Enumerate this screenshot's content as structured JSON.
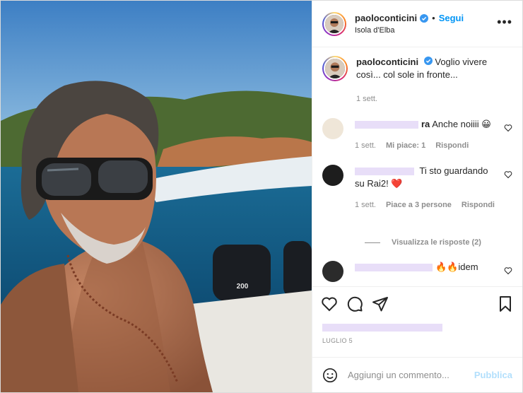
{
  "post": {
    "username": "paoloconticini",
    "follow_label": "Segui",
    "separator": "•",
    "location": "Isola d'Elba",
    "more_label": "•••",
    "caption": "Voglio vivere così... col sole in fronte...",
    "caption_time": "1 sett.",
    "date": "LUGLIO 5"
  },
  "media": {
    "boat_engine_label": "200"
  },
  "comments": [
    {
      "username_visible": "ra",
      "text": "Anche noiiii 😀",
      "time": "1 sett.",
      "likes": "Mi piace: 1",
      "reply": "Rispondi"
    },
    {
      "username_visible": "",
      "text": "Ti sto guardando su Rai2! ❤️",
      "time": "1 sett.",
      "likes": "Piace a 3 persone",
      "reply": "Rispondi"
    },
    {
      "username_visible": "",
      "text": "🔥🔥idem"
    }
  ],
  "view_replies": "Visualizza le risposte (2)",
  "add_comment": {
    "placeholder": "Aggiungi un commento...",
    "publish": "Pubblica"
  },
  "colors": {
    "link": "#0095f6",
    "publish_disabled": "#b2dffc",
    "verified": "#3897f0",
    "heart_red": "#ed4956"
  },
  "icons": [
    "verified-badge-icon",
    "heart-icon",
    "comment-icon",
    "share-icon",
    "bookmark-icon",
    "emoji-icon"
  ]
}
